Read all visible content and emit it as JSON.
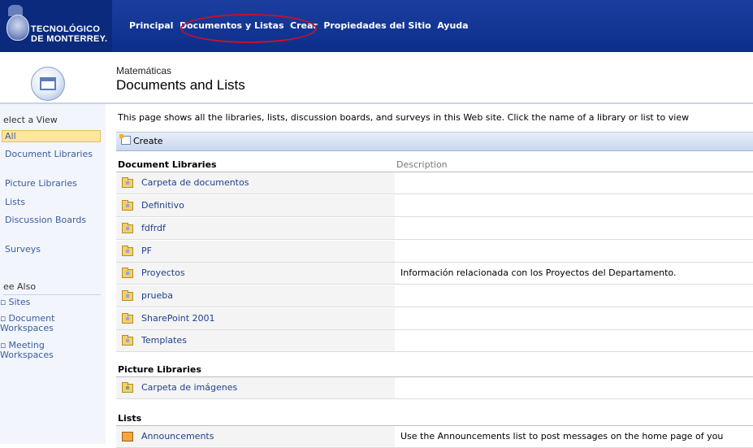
{
  "logo": {
    "line1": "TECNOLÓGICO",
    "line2": "DE MONTERREY."
  },
  "nav": {
    "items": [
      "Principal",
      "Documentos y Listas",
      "Crear",
      "Propiedades del Sitio",
      "Ayuda"
    ]
  },
  "header": {
    "site_name": "Matemáticas",
    "title": "Documents and Lists"
  },
  "leftnav": {
    "select_view_heading": "elect a View",
    "views": [
      "All",
      "Document Libraries",
      "Picture Libraries",
      "Lists",
      "Discussion Boards",
      "Surveys"
    ],
    "selected_view": "All",
    "see_also_heading": "ee Also",
    "see_also": [
      "Sites",
      "Document Workspaces",
      "Meeting Workspaces"
    ]
  },
  "intro_text": "This page shows all the libraries, lists, discussion boards, and surveys in this Web site. Click the name of a library or list to view",
  "toolbar": {
    "create_label": "Create"
  },
  "columns": {
    "description": "Description"
  },
  "sections": {
    "document_libraries": {
      "heading": "Document Libraries",
      "rows": [
        {
          "name": "Carpeta de documentos",
          "description": ""
        },
        {
          "name": "Definitivo",
          "description": ""
        },
        {
          "name": "fdfrdf",
          "description": ""
        },
        {
          "name": "PF",
          "description": ""
        },
        {
          "name": "Proyectos",
          "description": "Información relacionada con los Proyectos del Departamento."
        },
        {
          "name": "prueba",
          "description": ""
        },
        {
          "name": "SharePoint 2001",
          "description": ""
        },
        {
          "name": "Templates",
          "description": ""
        }
      ]
    },
    "picture_libraries": {
      "heading": "Picture Libraries",
      "rows": [
        {
          "name": "Carpeta de imágenes",
          "description": ""
        }
      ]
    },
    "lists": {
      "heading": "Lists",
      "rows": [
        {
          "name": "Announcements",
          "description": "Use the Announcements list to post messages on the home page of you"
        }
      ]
    }
  },
  "colors": {
    "topbar": "#1b3fa0",
    "link": "#1f3f8e",
    "selected_view": "#ffe69c",
    "highlight_circle": "#c8102e"
  }
}
